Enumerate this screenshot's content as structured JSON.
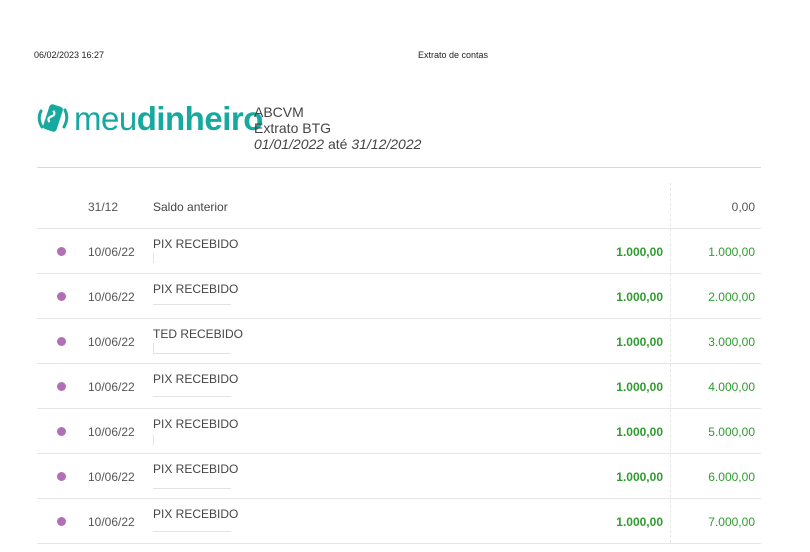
{
  "header": {
    "datetime": "06/02/2023 16:27",
    "title": "Extrato de contas"
  },
  "brand": {
    "icon": "meudinheiro-logo-icon",
    "word_light": "meu",
    "word_bold": "dinheiro",
    "color": "#17a9a0"
  },
  "account": {
    "name": "ABCVM",
    "statement": "Extrato BTG",
    "period_start": "01/01/2022",
    "period_conj": "até",
    "period_end": "31/12/2022"
  },
  "opening": {
    "date": "31/12",
    "label": "Saldo anterior",
    "balance": "0,00"
  },
  "transactions": [
    {
      "date": "10/06/22",
      "description": "PIX RECEBIDO",
      "amount": "1.000,00",
      "balance": "1.000,00"
    },
    {
      "date": "10/06/22",
      "description": "PIX RECEBIDO",
      "amount": "1.000,00",
      "balance": "2.000,00"
    },
    {
      "date": "10/06/22",
      "description": "TED RECEBIDO",
      "amount": "1.000,00",
      "balance": "3.000,00"
    },
    {
      "date": "10/06/22",
      "description": "PIX RECEBIDO",
      "amount": "1.000,00",
      "balance": "4.000,00"
    },
    {
      "date": "10/06/22",
      "description": "PIX RECEBIDO",
      "amount": "1.000,00",
      "balance": "5.000,00"
    },
    {
      "date": "10/06/22",
      "description": "PIX RECEBIDO",
      "amount": "1.000,00",
      "balance": "6.000,00"
    },
    {
      "date": "10/06/22",
      "description": "PIX RECEBIDO",
      "amount": "1.000,00",
      "balance": "7.000,00"
    }
  ],
  "colors": {
    "category_dot": "#b36fb5",
    "credit": "#2e9c2e"
  }
}
